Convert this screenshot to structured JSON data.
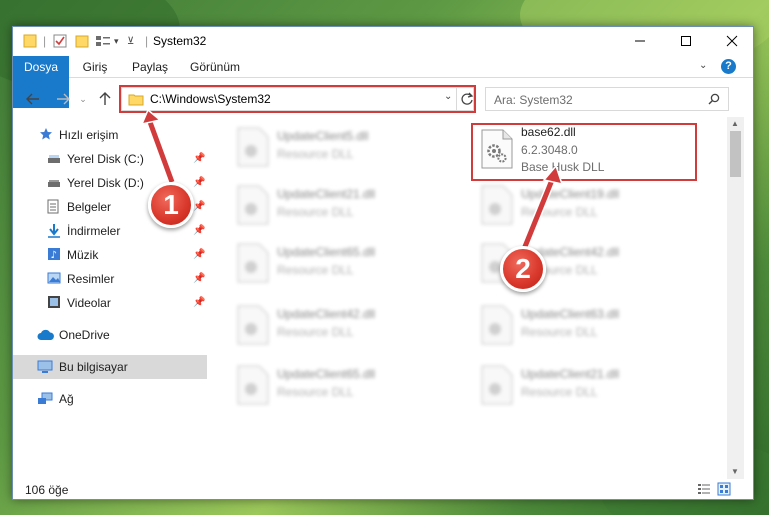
{
  "window": {
    "title": "System32"
  },
  "ribbon": {
    "tabs": [
      "Dosya",
      "Giriş",
      "Paylaş",
      "Görünüm"
    ]
  },
  "address": {
    "path": "C:\\Windows\\System32"
  },
  "search": {
    "placeholder": "Ara: System32"
  },
  "sidebar": {
    "items": [
      {
        "label": "Hızlı erişim",
        "icon": "star-icon",
        "pinned": false
      },
      {
        "label": "Yerel Disk (C:)",
        "icon": "drive-icon",
        "pinned": true
      },
      {
        "label": "Yerel Disk (D:)",
        "icon": "drive-icon",
        "pinned": true
      },
      {
        "label": "Belgeler",
        "icon": "document-icon",
        "pinned": true
      },
      {
        "label": "İndirmeler",
        "icon": "download-icon",
        "pinned": true
      },
      {
        "label": "Müzik",
        "icon": "music-icon",
        "pinned": true
      },
      {
        "label": "Resimler",
        "icon": "pictures-icon",
        "pinned": true
      },
      {
        "label": "Videolar",
        "icon": "video-icon",
        "pinned": true
      },
      {
        "label": "OneDrive",
        "icon": "cloud-icon",
        "pinned": false
      },
      {
        "label": "Bu bilgisayar",
        "icon": "computer-icon",
        "pinned": false,
        "selected": true
      },
      {
        "label": "Ağ",
        "icon": "network-icon",
        "pinned": false
      }
    ]
  },
  "files": {
    "left_column": [
      {
        "name": "UpdateClient5.dll",
        "type": "Resource DLL"
      },
      {
        "name": "UpdateClient21.dll",
        "type": "Resource DLL"
      },
      {
        "name": "UpdateClient65.dll",
        "type": "Resource DLL"
      },
      {
        "name": "UpdateClient42.dll",
        "type": "Resource DLL"
      },
      {
        "name": "UpdateClient65.dll",
        "type": "Resource DLL"
      }
    ],
    "highlighted": {
      "name": "base62.dll",
      "version": "6.2.3048.0",
      "description": "Base Husk DLL"
    },
    "right_column": [
      {
        "name": "UpdateClient19.dll",
        "type": "Resource DLL"
      },
      {
        "name": "UpdateClient42.dll",
        "type": "Resource DLL"
      },
      {
        "name": "UpdateClient63.dll",
        "type": "Resource DLL"
      },
      {
        "name": "UpdateClient21.dll",
        "type": "Resource DLL"
      }
    ]
  },
  "status": {
    "count": "106 öğe"
  },
  "callouts": [
    "1",
    "2"
  ],
  "colors": {
    "accent": "#1979ca",
    "highlight": "#d23b3b"
  }
}
